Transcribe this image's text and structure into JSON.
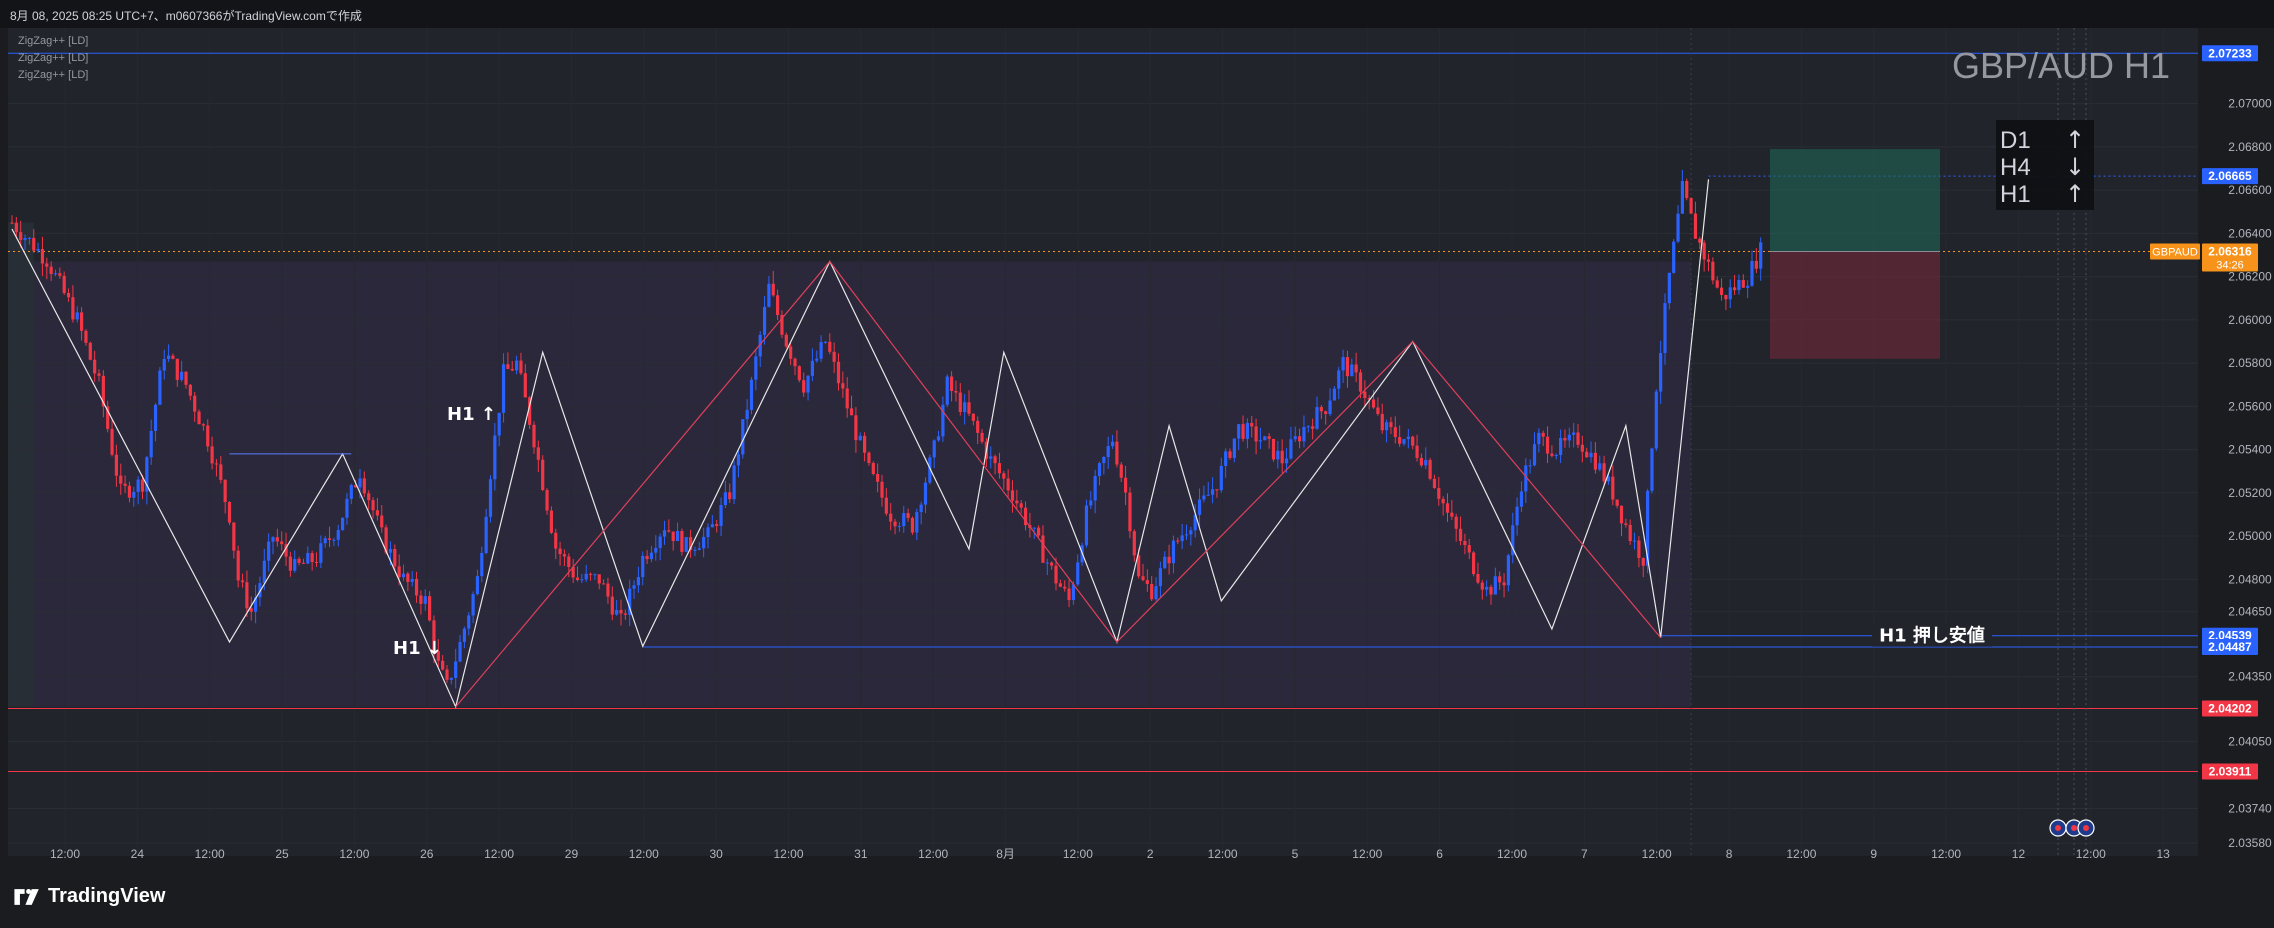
{
  "header": {
    "caption": "8月 08, 2025 08:25 UTC+7、m0607366がTradingView.comで作成"
  },
  "indicators": [
    "ZigZag++ [LD]",
    "ZigZag++ [LD]",
    "ZigZag++ [LD]"
  ],
  "watermark": "GBP/AUD H1",
  "trend_table": [
    {
      "tf": "D1",
      "dir": "↑"
    },
    {
      "tf": "H4",
      "dir": "↓"
    },
    {
      "tf": "H1",
      "dir": "↑"
    }
  ],
  "annotations": {
    "h1_up": "H1 ↑",
    "h1_down": "H1 ↓",
    "h1_support": "H1 押し安値"
  },
  "price_badges": [
    {
      "price": "2.07233",
      "value": 2.07233,
      "color": "#2962ff"
    },
    {
      "price": "2.06665",
      "value": 2.06665,
      "color": "#2962ff"
    },
    {
      "price": "2.04539",
      "value": 2.04539,
      "color": "#2962ff"
    },
    {
      "price": "2.04487",
      "value": 2.04487,
      "color": "#2962ff"
    },
    {
      "price": "2.04202",
      "value": 2.04202,
      "color": "#f23645"
    },
    {
      "price": "2.03911",
      "value": 2.03911,
      "color": "#f23645"
    }
  ],
  "current_price": {
    "symbol": "GBPAUD",
    "price": "2.06316",
    "countdown": "34:26",
    "value": 2.06316,
    "color": "#f7931a"
  },
  "brand": "TradingView",
  "colors": {
    "bull": "#2962ff",
    "bear": "#f23645",
    "background": "#1b1c20"
  },
  "chart_data": {
    "type": "candlestick",
    "symbol": "GBPAUD",
    "timeframe": "H1",
    "ylim": [
      2.0352,
      2.0735
    ],
    "y_ticks": [
      "2.07000",
      "2.06800",
      "2.06600",
      "2.06400",
      "2.06200",
      "2.06000",
      "2.05800",
      "2.05600",
      "2.05400",
      "2.05200",
      "2.05000",
      "2.04800",
      "2.04650",
      "2.04350",
      "2.04050",
      "2.03740",
      "2.03580"
    ],
    "x_ticks": [
      "12:00",
      "24",
      "12:00",
      "25",
      "12:00",
      "26",
      "12:00",
      "29",
      "12:00",
      "30",
      "12:00",
      "31",
      "12:00",
      "8月",
      "12:00",
      "2",
      "12:00",
      "5",
      "12:00",
      "6",
      "12:00",
      "7",
      "12:00",
      "8",
      "12:00",
      "9",
      "12:00",
      "12",
      "12:00",
      "13"
    ],
    "close_path": [
      [
        0,
        2.0645
      ],
      [
        8,
        2.0628
      ],
      [
        15,
        2.06
      ],
      [
        20,
        2.057
      ],
      [
        25,
        2.052
      ],
      [
        30,
        2.0525
      ],
      [
        35,
        2.0585
      ],
      [
        40,
        2.057
      ],
      [
        45,
        2.0545
      ],
      [
        50,
        2.051
      ],
      [
        52,
        2.048
      ],
      [
        55,
        2.0465
      ],
      [
        60,
        2.05
      ],
      [
        65,
        2.0485
      ],
      [
        70,
        2.049
      ],
      [
        75,
        2.0505
      ],
      [
        78,
        2.052
      ],
      [
        80,
        2.053
      ],
      [
        85,
        2.05
      ],
      [
        90,
        2.048
      ],
      [
        95,
        2.047
      ],
      [
        98,
        2.044
      ],
      [
        100,
        2.043
      ],
      [
        103,
        2.045
      ],
      [
        107,
        2.048
      ],
      [
        110,
        2.053
      ],
      [
        113,
        2.0575
      ],
      [
        116,
        2.058
      ],
      [
        120,
        2.0545
      ],
      [
        125,
        2.0495
      ],
      [
        130,
        2.048
      ],
      [
        135,
        2.048
      ],
      [
        140,
        2.046
      ],
      [
        145,
        2.049
      ],
      [
        150,
        2.0505
      ],
      [
        155,
        2.0495
      ],
      [
        160,
        2.05
      ],
      [
        165,
        2.052
      ],
      [
        170,
        2.057
      ],
      [
        174,
        2.0615
      ],
      [
        178,
        2.059
      ],
      [
        182,
        2.057
      ],
      [
        187,
        2.059
      ],
      [
        192,
        2.056
      ],
      [
        197,
        2.053
      ],
      [
        202,
        2.051
      ],
      [
        207,
        2.0505
      ],
      [
        212,
        2.054
      ],
      [
        215,
        2.057
      ],
      [
        220,
        2.0555
      ],
      [
        225,
        2.0535
      ],
      [
        230,
        2.052
      ],
      [
        235,
        2.05
      ],
      [
        240,
        2.048
      ],
      [
        243,
        2.047
      ],
      [
        247,
        2.051
      ],
      [
        250,
        2.053
      ],
      [
        253,
        2.0545
      ],
      [
        256,
        2.052
      ],
      [
        259,
        2.048
      ],
      [
        262,
        2.0475
      ],
      [
        267,
        2.0495
      ],
      [
        272,
        2.051
      ],
      [
        277,
        2.0525
      ],
      [
        282,
        2.055
      ],
      [
        287,
        2.0545
      ],
      [
        292,
        2.0535
      ],
      [
        297,
        2.055
      ],
      [
        302,
        2.056
      ],
      [
        306,
        2.058
      ],
      [
        310,
        2.057
      ],
      [
        315,
        2.055
      ],
      [
        320,
        2.0545
      ],
      [
        325,
        2.0535
      ],
      [
        330,
        2.051
      ],
      [
        335,
        2.049
      ],
      [
        339,
        2.0475
      ],
      [
        343,
        2.048
      ],
      [
        347,
        2.0525
      ],
      [
        351,
        2.0545
      ],
      [
        355,
        2.054
      ],
      [
        360,
        2.0545
      ],
      [
        364,
        2.0535
      ],
      [
        368,
        2.052
      ],
      [
        372,
        2.05
      ],
      [
        375,
        2.049
      ],
      [
        378,
        2.057
      ],
      [
        381,
        2.062
      ],
      [
        384,
        2.066
      ],
      [
        387,
        2.064
      ],
      [
        390,
        2.0625
      ],
      [
        393,
        2.061
      ],
      [
        396,
        2.0615
      ],
      [
        399,
        2.062
      ],
      [
        402,
        2.0632
      ]
    ],
    "zigzag_white": [
      [
        0,
        2.0642
      ],
      [
        50,
        2.0451
      ],
      [
        76,
        2.0538
      ],
      [
        102,
        2.0421
      ],
      [
        122,
        2.0585
      ],
      [
        145,
        2.0449
      ],
      [
        188,
        2.0627
      ],
      [
        220,
        2.0494
      ],
      [
        228,
        2.0585
      ],
      [
        254,
        2.0451
      ],
      [
        266,
        2.0551
      ],
      [
        278,
        2.047
      ],
      [
        322,
        2.059
      ],
      [
        354,
        2.0457
      ],
      [
        371,
        2.0551
      ],
      [
        379,
        2.0453
      ],
      [
        390,
        2.0665
      ]
    ],
    "zigzag_red": [
      [
        102,
        2.0421
      ],
      [
        188,
        2.0627
      ],
      [
        254,
        2.0451
      ],
      [
        322,
        2.059
      ],
      [
        379,
        2.0453
      ]
    ],
    "levels": [
      {
        "value": 2.07233,
        "color": "#2962ff",
        "style": "solid"
      },
      {
        "value": 2.06665,
        "color": "#2962ff",
        "style": "dotted"
      },
      {
        "value": 2.06316,
        "color": "#f7931a",
        "style": "dotted"
      },
      {
        "value": 2.04539,
        "color": "#2962ff",
        "style": "solid"
      },
      {
        "value": 2.04487,
        "color": "#2962ff",
        "style": "solid"
      },
      {
        "value": 2.04202,
        "color": "#f23645",
        "style": "solid"
      },
      {
        "value": 2.03911,
        "color": "#f23645",
        "style": "solid"
      }
    ],
    "position": {
      "entry": 2.06316,
      "target": 2.0679,
      "stop": 2.0582
    }
  }
}
